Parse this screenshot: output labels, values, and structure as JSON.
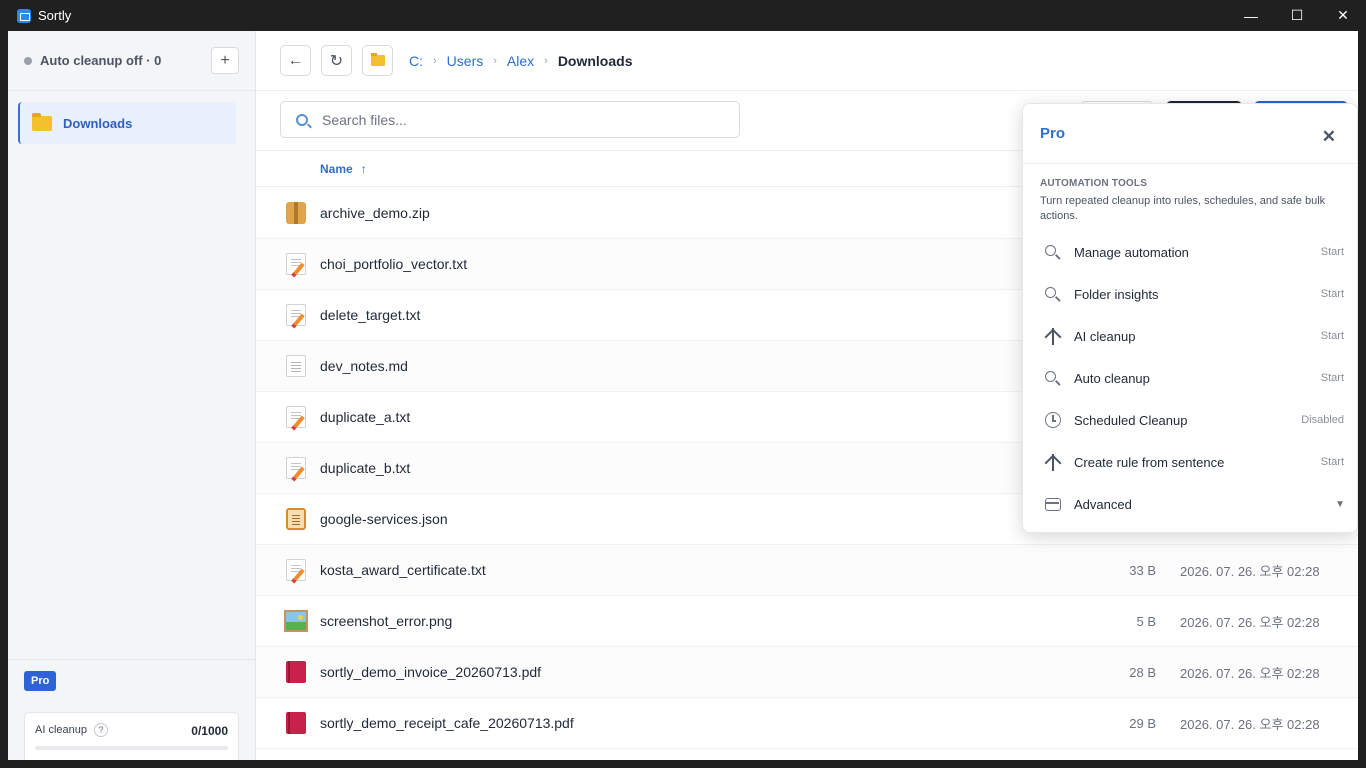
{
  "window": {
    "title": "Sortly",
    "minimize": "—",
    "maximize": "☐",
    "close": "✕"
  },
  "sidebar": {
    "status": "Auto cleanup off · 0",
    "add_label": "+",
    "folders": [
      {
        "label": "Downloads"
      }
    ],
    "pro_badge": "Pro",
    "ai_card": {
      "label": "AI cleanup",
      "help": "?",
      "count": "0/1000",
      "usage_fraction": 0.0
    }
  },
  "toolbar": {
    "back": "←",
    "refresh": "↻",
    "breadcrumb": [
      "C:",
      "Users",
      "Alex",
      "Downloads"
    ],
    "separator": "›"
  },
  "search": {
    "placeholder": "Search files..."
  },
  "table": {
    "name_header": "Name",
    "sort_indicator": "↑",
    "files": [
      {
        "name": "archive_demo.zip",
        "icon": "zip-icon",
        "size": "",
        "date": ""
      },
      {
        "name": "choi_portfolio_vector.txt",
        "icon": "txt-icon",
        "size": "",
        "date": ""
      },
      {
        "name": "delete_target.txt",
        "icon": "txt-icon",
        "size": "",
        "date": ""
      },
      {
        "name": "dev_notes.md",
        "icon": "md-icon",
        "size": "",
        "date": ""
      },
      {
        "name": "duplicate_a.txt",
        "icon": "txt-icon",
        "size": "",
        "date": ""
      },
      {
        "name": "duplicate_b.txt",
        "icon": "txt-icon",
        "size": "",
        "date": ""
      },
      {
        "name": "google-services.json",
        "icon": "json-icon",
        "size": "",
        "date": ""
      },
      {
        "name": "kosta_award_certificate.txt",
        "icon": "txt-icon",
        "size": "33 B",
        "date": "2026. 07. 26. 오후 02:28"
      },
      {
        "name": "screenshot_error.png",
        "icon": "image-icon",
        "size": "5 B",
        "date": "2026. 07. 26. 오후 02:28"
      },
      {
        "name": "sortly_demo_invoice_20260713.pdf",
        "icon": "pdf-icon",
        "size": "28 B",
        "date": "2026. 07. 26. 오후 02:28"
      },
      {
        "name": "sortly_demo_receipt_cafe_20260713.pdf",
        "icon": "pdf-icon",
        "size": "29 B",
        "date": "2026. 07. 26. 오후 02:28"
      }
    ]
  },
  "pro_panel": {
    "title": "Pro",
    "close": "✕",
    "section_title": "AUTOMATION TOOLS",
    "section_desc": "Turn repeated cleanup into rules, schedules, and safe bulk actions.",
    "items": [
      {
        "label": "Manage automation",
        "status": "Start",
        "icon": "search-icon"
      },
      {
        "label": "Folder insights",
        "status": "Start",
        "icon": "search-icon"
      },
      {
        "label": "AI cleanup",
        "status": "Start",
        "icon": "ai-icon"
      },
      {
        "label": "Auto cleanup",
        "status": "Start",
        "icon": "search-icon"
      },
      {
        "label": "Scheduled Cleanup",
        "status": "Disabled",
        "icon": "clock-icon"
      },
      {
        "label": "Create rule from sentence",
        "status": "Start",
        "icon": "ai-icon"
      },
      {
        "label": "Advanced",
        "status": "▼",
        "icon": "box-icon"
      }
    ]
  },
  "colors": {
    "accent": "#2f6fcf",
    "pro_badge": "#2d63d6",
    "folder": "#f5c02e"
  }
}
